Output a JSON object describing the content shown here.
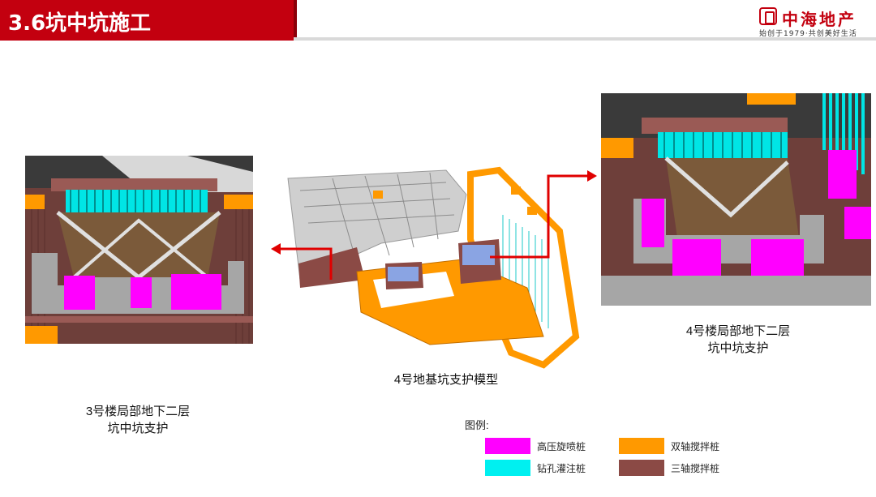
{
  "header": {
    "title": "3.6坑中坑施工",
    "logo_name": "中海地产",
    "logo_slogan": "始创于1979·共创美好生活"
  },
  "captions": {
    "left": [
      "3号楼局部地下二层",
      "坑中坑支护"
    ],
    "center": "4号地基坑支护模型",
    "right": [
      "4号楼局部地下二层",
      "坑中坑支护"
    ]
  },
  "legend": {
    "title": "图例:",
    "items": [
      {
        "label": "高压旋喷桩",
        "color": "#ff00ff"
      },
      {
        "label": "双轴搅拌桩",
        "color": "#ff9900"
      },
      {
        "label": "钻孔灌注桩",
        "color": "#00f0f0"
      },
      {
        "label": "三轴搅拌桩",
        "color": "#8b4a45"
      }
    ]
  },
  "colors": {
    "brand_red": "#c3000f",
    "arrow_red": "#e00000"
  }
}
